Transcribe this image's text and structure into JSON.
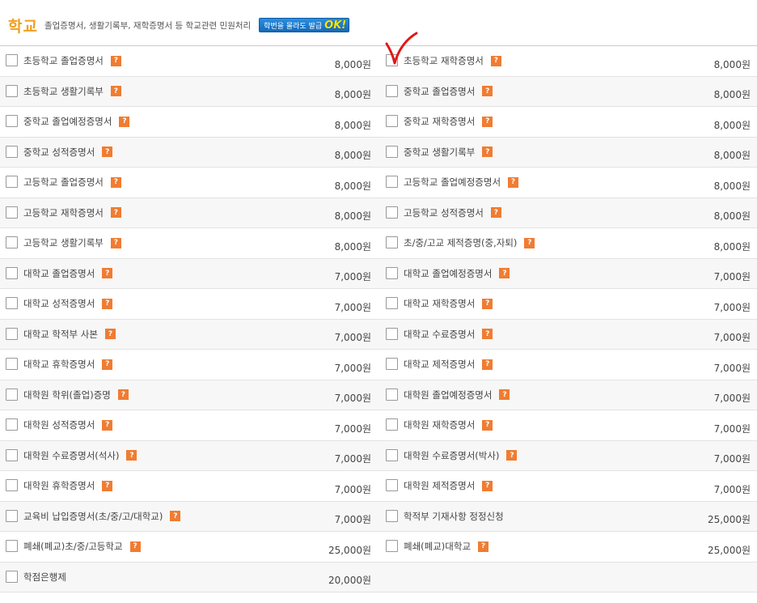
{
  "header": {
    "title": "학교",
    "desc": "졸업증명서, 생활기록부, 재학증명서 등 학교관련 민원처리",
    "badge_text": "학번을 몰라도 발급",
    "badge_ok": "OK!"
  },
  "help_glyph": "?",
  "rows": [
    {
      "left": {
        "label": "초등학교 졸업증명서",
        "price": "8,000원",
        "help": true
      },
      "right": {
        "label": "초등학교 재학증명서",
        "price": "8,000원",
        "help": true
      }
    },
    {
      "left": {
        "label": "초등학교 생활기록부",
        "price": "8,000원",
        "help": true
      },
      "right": {
        "label": "중학교 졸업증명서",
        "price": "8,000원",
        "help": true
      }
    },
    {
      "left": {
        "label": "중학교 졸업예정증명서",
        "price": "8,000원",
        "help": true
      },
      "right": {
        "label": "중학교 재학증명서",
        "price": "8,000원",
        "help": true
      }
    },
    {
      "left": {
        "label": "중학교 성적증명서",
        "price": "8,000원",
        "help": true
      },
      "right": {
        "label": "중학교 생활기록부",
        "price": "8,000원",
        "help": true
      }
    },
    {
      "left": {
        "label": "고등학교 졸업증명서",
        "price": "8,000원",
        "help": true
      },
      "right": {
        "label": "고등학교 졸업예정증명서",
        "price": "8,000원",
        "help": true
      }
    },
    {
      "left": {
        "label": "고등학교 재학증명서",
        "price": "8,000원",
        "help": true
      },
      "right": {
        "label": "고등학교 성적증명서",
        "price": "8,000원",
        "help": true
      }
    },
    {
      "left": {
        "label": "고등학교 생활기록부",
        "price": "8,000원",
        "help": true
      },
      "right": {
        "label": "초/중/고교 제적증명(중,자퇴)",
        "price": "8,000원",
        "help": true
      }
    },
    {
      "left": {
        "label": "대학교 졸업증명서",
        "price": "7,000원",
        "help": true
      },
      "right": {
        "label": "대학교 졸업예정증명서",
        "price": "7,000원",
        "help": true
      }
    },
    {
      "left": {
        "label": "대학교 성적증명서",
        "price": "7,000원",
        "help": true
      },
      "right": {
        "label": "대학교 재학증명서",
        "price": "7,000원",
        "help": true
      }
    },
    {
      "left": {
        "label": "대학교 학적부 사본",
        "price": "7,000원",
        "help": true
      },
      "right": {
        "label": "대학교 수료증명서",
        "price": "7,000원",
        "help": true
      }
    },
    {
      "left": {
        "label": "대학교 휴학증명서",
        "price": "7,000원",
        "help": true
      },
      "right": {
        "label": "대학교 제적증명서",
        "price": "7,000원",
        "help": true
      }
    },
    {
      "left": {
        "label": "대학원 학위(졸업)증명",
        "price": "7,000원",
        "help": true
      },
      "right": {
        "label": "대학원 졸업예정증명서",
        "price": "7,000원",
        "help": true
      }
    },
    {
      "left": {
        "label": "대학원 성적증명서",
        "price": "7,000원",
        "help": true
      },
      "right": {
        "label": "대학원 재학증명서",
        "price": "7,000원",
        "help": true
      }
    },
    {
      "left": {
        "label": "대학원 수료증명서(석사)",
        "price": "7,000원",
        "help": true
      },
      "right": {
        "label": "대학원 수료증명서(박사)",
        "price": "7,000원",
        "help": true
      }
    },
    {
      "left": {
        "label": "대학원 휴학증명서",
        "price": "7,000원",
        "help": true
      },
      "right": {
        "label": "대학원 제적증명서",
        "price": "7,000원",
        "help": true
      }
    },
    {
      "left": {
        "label": "교육비 납입증명서(초/중/고/대학교)",
        "price": "7,000원",
        "help": true
      },
      "right": {
        "label": "학적부 기재사항 정정신청",
        "price": "25,000원",
        "help": false
      }
    },
    {
      "left": {
        "label": "폐쇄(폐교)초/중/고등학교",
        "price": "25,000원",
        "help": true
      },
      "right": {
        "label": "폐쇄(폐교)대학교",
        "price": "25,000원",
        "help": true
      }
    },
    {
      "left": {
        "label": "학점은행제",
        "price": "20,000원",
        "help": false
      },
      "right": null
    }
  ],
  "annotation": {
    "color": "#e01818"
  }
}
